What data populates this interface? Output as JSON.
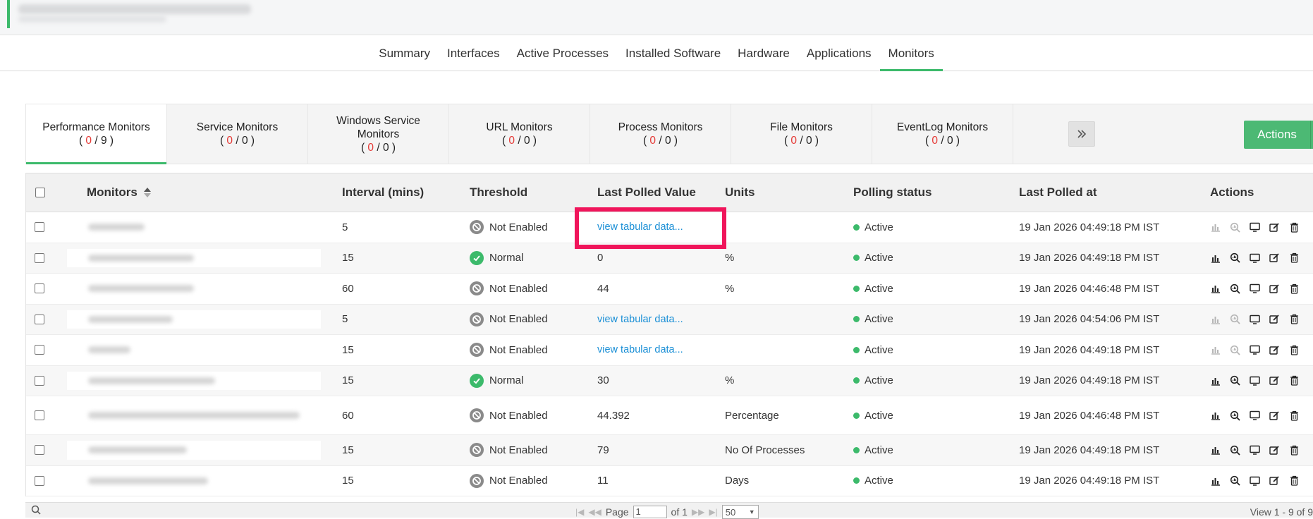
{
  "main_tabs": [
    "Summary",
    "Interfaces",
    "Active Processes",
    "Installed Software",
    "Hardware",
    "Applications",
    "Monitors"
  ],
  "main_tab_active": "Monitors",
  "category_tabs": [
    {
      "label": "Performance Monitors",
      "count_active": "0",
      "count_total": "9"
    },
    {
      "label": "Service Monitors",
      "count_active": "0",
      "count_total": "0"
    },
    {
      "label": "Windows Service Monitors",
      "count_active": "0",
      "count_total": "0"
    },
    {
      "label": "URL Monitors",
      "count_active": "0",
      "count_total": "0"
    },
    {
      "label": "Process Monitors",
      "count_active": "0",
      "count_total": "0"
    },
    {
      "label": "File Monitors",
      "count_active": "0",
      "count_total": "0"
    },
    {
      "label": "EventLog Monitors",
      "count_active": "0",
      "count_total": "0"
    }
  ],
  "more_tabs_icon": "double-chevron-right-icon",
  "actions_button": {
    "label": "Actions"
  },
  "table": {
    "headers": {
      "monitors": "Monitors",
      "interval": "Interval (mins)",
      "threshold": "Threshold",
      "last_polled_value": "Last Polled Value",
      "units": "Units",
      "polling_status": "Polling status",
      "last_polled_at": "Last Polled at",
      "actions": "Actions"
    },
    "rows": [
      {
        "interval": "5",
        "threshold": "Not Enabled",
        "threshold_state": "disabled",
        "value": "view tabular data...",
        "value_is_link": true,
        "units": "",
        "status": "Active",
        "polled_at": "19 Jan 2026 04:49:18 PM IST",
        "graph_enabled": false
      },
      {
        "interval": "15",
        "threshold": "Normal",
        "threshold_state": "ok",
        "value": "0",
        "value_is_link": false,
        "units": "%",
        "status": "Active",
        "polled_at": "19 Jan 2026 04:49:18 PM IST",
        "graph_enabled": true
      },
      {
        "interval": "60",
        "threshold": "Not Enabled",
        "threshold_state": "disabled",
        "value": "44",
        "value_is_link": false,
        "units": "%",
        "status": "Active",
        "polled_at": "19 Jan 2026 04:46:48 PM IST",
        "graph_enabled": true
      },
      {
        "interval": "5",
        "threshold": "Not Enabled",
        "threshold_state": "disabled",
        "value": "view tabular data...",
        "value_is_link": true,
        "units": "",
        "status": "Active",
        "polled_at": "19 Jan 2026 04:54:06 PM IST",
        "graph_enabled": false
      },
      {
        "interval": "15",
        "threshold": "Not Enabled",
        "threshold_state": "disabled",
        "value": "view tabular data...",
        "value_is_link": true,
        "units": "",
        "status": "Active",
        "polled_at": "19 Jan 2026 04:49:18 PM IST",
        "graph_enabled": false
      },
      {
        "interval": "15",
        "threshold": "Normal",
        "threshold_state": "ok",
        "value": "30",
        "value_is_link": false,
        "units": "%",
        "status": "Active",
        "polled_at": "19 Jan 2026 04:49:18 PM IST",
        "graph_enabled": true
      },
      {
        "interval": "60",
        "threshold": "Not Enabled",
        "threshold_state": "disabled",
        "value": "44.392",
        "value_is_link": false,
        "units": "Percentage",
        "status": "Active",
        "polled_at": "19 Jan 2026 04:46:48 PM IST",
        "graph_enabled": true
      },
      {
        "interval": "15",
        "threshold": "Not Enabled",
        "threshold_state": "disabled",
        "value": "79",
        "value_is_link": false,
        "units": "No Of Processes",
        "status": "Active",
        "polled_at": "19 Jan 2026 04:49:18 PM IST",
        "graph_enabled": true
      },
      {
        "interval": "15",
        "threshold": "Not Enabled",
        "threshold_state": "disabled",
        "value": "11",
        "value_is_link": false,
        "units": "Days",
        "status": "Active",
        "polled_at": "19 Jan 2026 04:49:18 PM IST",
        "graph_enabled": true
      }
    ]
  },
  "pager": {
    "page_label": "Page",
    "page_value": "1",
    "of_label": "of 1",
    "page_size": "50",
    "view_text": "View 1 - 9 of 9"
  },
  "colors": {
    "accent": "#3cba6b",
    "link": "#1a8fd6",
    "highlight": "#f0155b",
    "count_red": "#e53935"
  }
}
